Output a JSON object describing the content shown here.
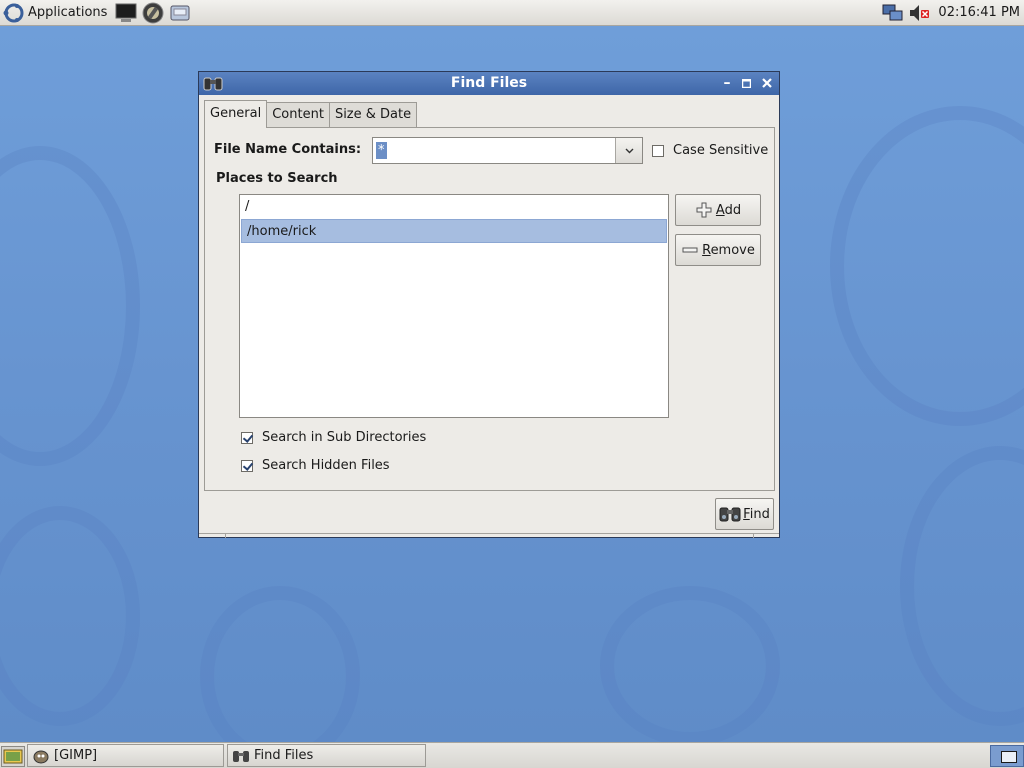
{
  "top_panel": {
    "applications_label": "Applications",
    "launchers": [
      "terminal-icon",
      "gimp-icon",
      "disk-icon"
    ],
    "tray": [
      "network-icon",
      "volume-muted-icon"
    ],
    "clock": "02:16:41 PM"
  },
  "dialog": {
    "title": "Find Files",
    "tabs": [
      {
        "label": "General",
        "active": true
      },
      {
        "label": "Content",
        "active": false
      },
      {
        "label": "Size & Date",
        "active": false
      }
    ],
    "file_name_label": "File Name Contains:",
    "file_name_value": "*",
    "case_sensitive_label": "Case Sensitive",
    "case_sensitive_checked": false,
    "places_label": "Places to Search",
    "places": [
      {
        "path": "/",
        "selected": false
      },
      {
        "path": "/home/rick",
        "selected": true
      }
    ],
    "add_label_prefix": "",
    "add_mnemonic": "A",
    "add_label_rest": "dd",
    "remove_mnemonic": "R",
    "remove_label_rest": "emove",
    "sub_dirs_label": "Search in Sub Directories",
    "sub_dirs_checked": true,
    "hidden_label": "Search Hidden Files",
    "hidden_checked": true,
    "find_mnemonic": "F",
    "find_label_rest": "ind"
  },
  "taskbar": {
    "items": [
      {
        "label": "[GIMP]",
        "icon": "gimp-icon"
      },
      {
        "label": "Find Files",
        "icon": "binoculars-icon"
      }
    ]
  },
  "colors": {
    "desktop": "#6e9bd6",
    "titlebar": "#4a72b4",
    "selection": "#a6bde0"
  }
}
